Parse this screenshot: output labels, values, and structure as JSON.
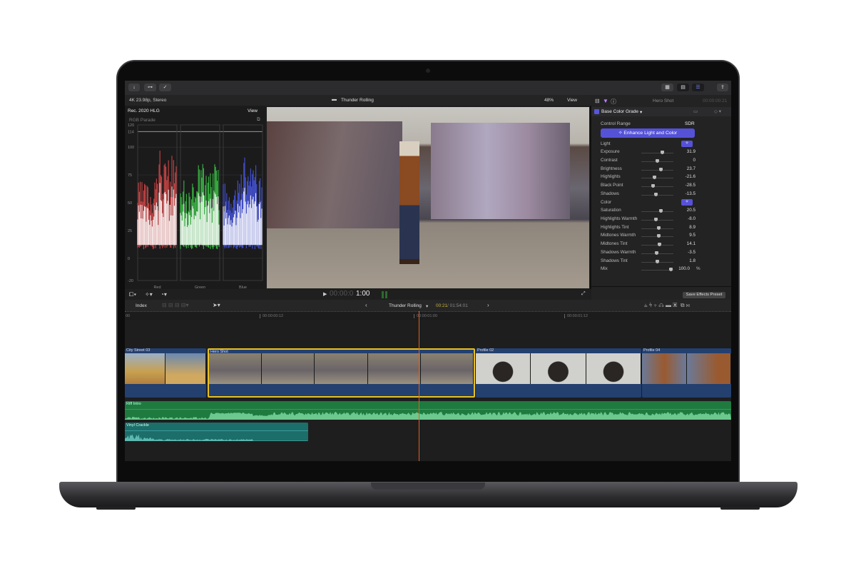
{
  "toolbar": {
    "icons": [
      "import-icon",
      "keyword-icon",
      "checkmark-icon"
    ],
    "right_icons": [
      "browser-layout-icon",
      "timeline-layout-icon",
      "inspector-layout-icon",
      "share-icon"
    ]
  },
  "infobar": {
    "format": "4K 23.98p, Stereo",
    "project": "Thunder Rolling",
    "zoom": "48%",
    "view": "View"
  },
  "scopes": {
    "color_space": "Rec. 2020 HLG",
    "view": "View",
    "scope_type": "RGB Parade",
    "y_ticks": [
      "120",
      "114",
      "100",
      "75",
      "50",
      "25",
      "0",
      "-20"
    ],
    "channels": [
      "Red",
      "Green",
      "Blue"
    ]
  },
  "viewer": {
    "timecode_dim": "00:00:0",
    "timecode": "1:00"
  },
  "inspector": {
    "clip_name": "Hero Shot",
    "timecode": "00:00:00:21",
    "effect": "Base Color Grade",
    "control_range_label": "Control Range",
    "control_range_value": "SDR",
    "enhance_button": "Enhance Light and Color",
    "light_label": "Light",
    "color_label": "Color",
    "light_params": [
      {
        "label": "Exposure",
        "value": "31.9",
        "level": 0.65
      },
      {
        "label": "Contrast",
        "value": "0",
        "level": 0.5
      },
      {
        "label": "Brightness",
        "value": "23.7",
        "level": 0.62
      },
      {
        "label": "Highlights",
        "value": "-21.6",
        "level": 0.4
      },
      {
        "label": "Black Point",
        "value": "-28.5",
        "level": 0.37
      },
      {
        "label": "Shadows",
        "value": "-13.5",
        "level": 0.45
      }
    ],
    "color_params": [
      {
        "label": "Saturation",
        "value": "20.5",
        "level": 0.6
      },
      {
        "label": "Highlights Warmth",
        "value": "-8.0",
        "level": 0.46
      },
      {
        "label": "Highlights Tint",
        "value": "8.9",
        "level": 0.54
      },
      {
        "label": "Midtones Warmth",
        "value": "9.5",
        "level": 0.54
      },
      {
        "label": "Midtones Tint",
        "value": "14.1",
        "level": 0.56
      },
      {
        "label": "Shadows Warmth",
        "value": "-3.5",
        "level": 0.48
      },
      {
        "label": "Shadows Tint",
        "value": "1.8",
        "level": 0.51
      }
    ],
    "mix_label": "Mix",
    "mix_value": "100.0",
    "mix_unit": "%",
    "save_preset": "Save Effects Preset"
  },
  "timeline": {
    "index": "Index",
    "project": "Thunder Rolling",
    "position": "00:21",
    "duration": "/ 01:54:01",
    "ruler": [
      "00",
      "00:00:00:12",
      "00:00:01:00",
      "00:00:01:12"
    ],
    "video_clips": [
      "City Street 03",
      "Hero Shot",
      "Profile 02",
      "Profile 04"
    ],
    "audio_clips": [
      "Riff Intro",
      "Vinyl Crackle"
    ]
  },
  "colors": {
    "accent": "#5856d6",
    "selection": "#e8c020",
    "playhead": "#e06020",
    "video_clip": "#23406e",
    "audio_music": "#1e7a3e",
    "audio_fx": "#1c6e6a"
  }
}
